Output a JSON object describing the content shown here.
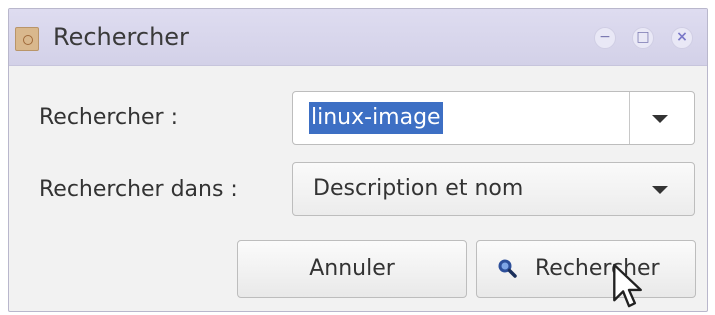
{
  "window": {
    "title": "Rechercher",
    "icon": "app-package-icon",
    "controls": {
      "minimize": "−",
      "maximize": "□",
      "close": "×"
    }
  },
  "form": {
    "search_label": "Rechercher :",
    "search_value": "linux-image",
    "search_in_label": "Rechercher dans :",
    "search_in_value": "Description et nom"
  },
  "buttons": {
    "cancel_label": "Annuler",
    "search_label": "Rechercher"
  },
  "colors": {
    "titlebar": "#d3d1e8",
    "selection": "#3d6fc4",
    "search_icon": "#2d4f9a"
  }
}
